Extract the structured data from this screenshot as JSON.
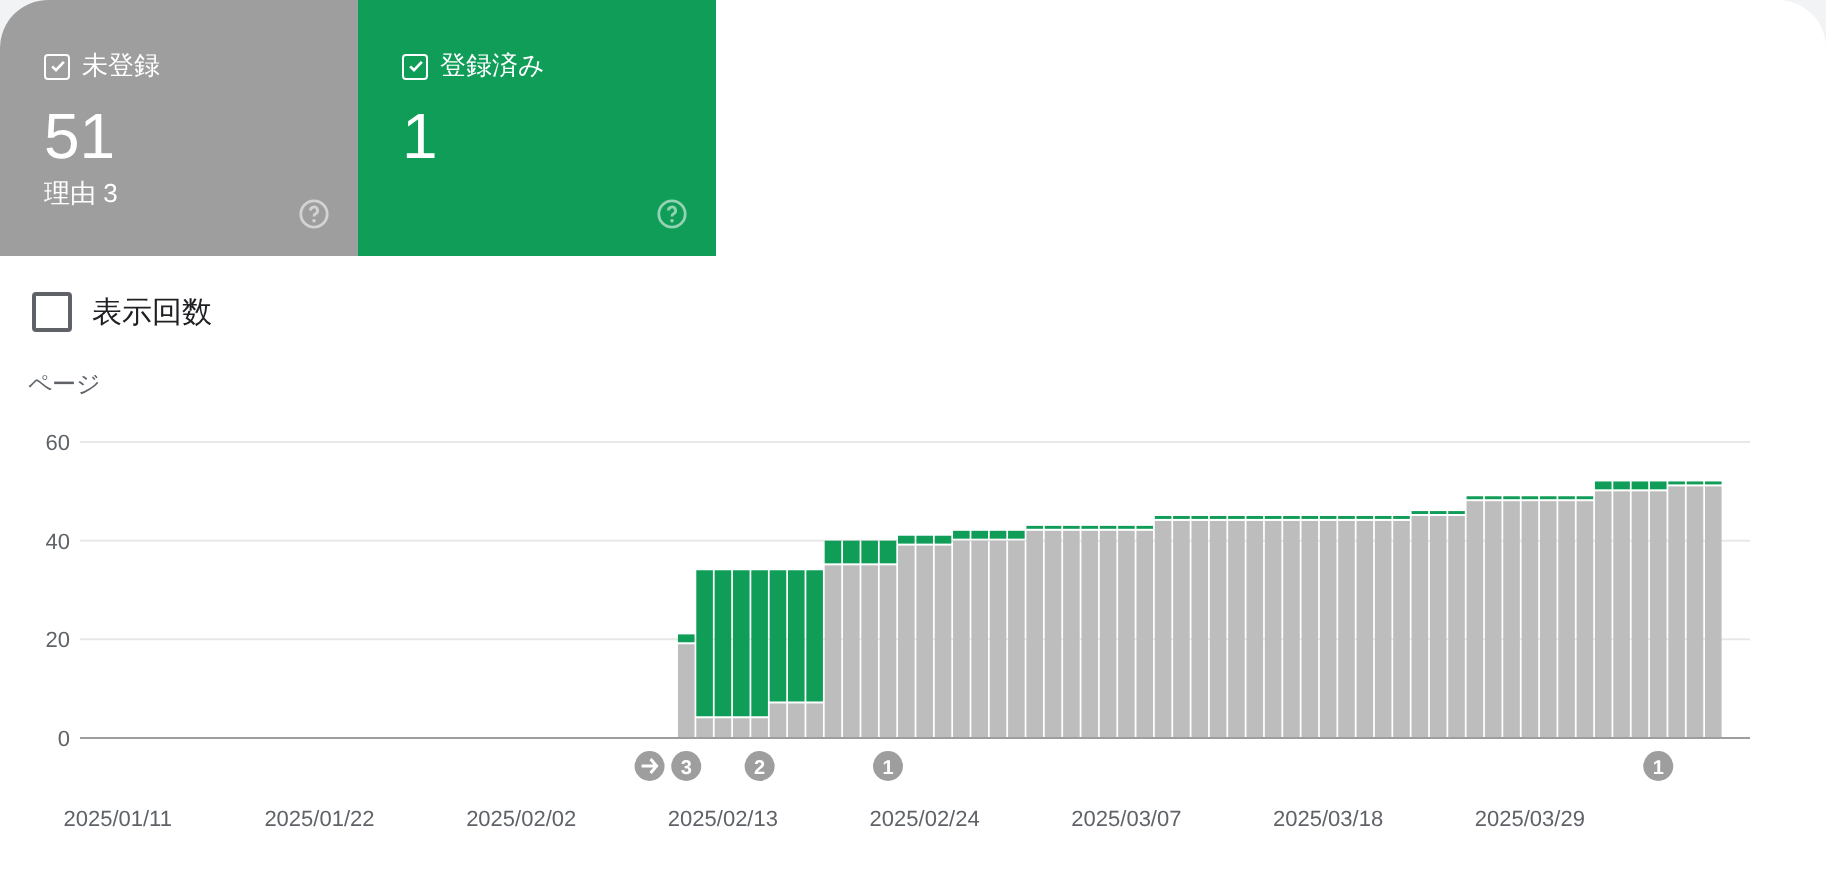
{
  "tiles": [
    {
      "label": "未登録",
      "count": "51",
      "subtitle": "理由 3",
      "checked": true,
      "color": "#9e9e9e"
    },
    {
      "label": "登録済み",
      "count": "1",
      "checked": true,
      "color": "#0f9d58"
    }
  ],
  "impressions_toggle": {
    "label": "表示回数",
    "checked": false
  },
  "chart": {
    "chart_data": {
      "type": "bar",
      "stacked": true,
      "ylabel": "ページ",
      "ylim": [
        0,
        60
      ],
      "yticks": [
        0,
        20,
        40,
        60
      ],
      "categories": [
        null,
        "2025/01/11",
        null,
        null,
        null,
        null,
        null,
        null,
        null,
        null,
        null,
        null,
        "2025/01/22",
        null,
        null,
        null,
        null,
        null,
        null,
        null,
        null,
        null,
        null,
        "2025/02/02",
        null,
        null,
        null,
        null,
        null,
        null,
        null,
        null,
        null,
        null,
        "2025/02/13",
        null,
        null,
        null,
        null,
        null,
        null,
        null,
        null,
        null,
        null,
        "2025/02/24",
        null,
        null,
        null,
        null,
        null,
        null,
        null,
        null,
        null,
        null,
        "2025/03/07",
        null,
        null,
        null,
        null,
        null,
        null,
        null,
        null,
        null,
        null,
        "2025/03/18",
        null,
        null,
        null,
        null,
        null,
        null,
        null,
        null,
        null,
        null,
        "2025/03/29",
        null,
        null,
        null,
        null,
        null,
        null,
        null,
        null,
        null,
        null,
        null,
        null
      ],
      "series": [
        {
          "color": "#bdbdbd",
          "values": [
            null,
            null,
            null,
            null,
            null,
            null,
            null,
            null,
            null,
            null,
            null,
            null,
            null,
            null,
            null,
            null,
            null,
            null,
            null,
            null,
            null,
            null,
            null,
            null,
            null,
            null,
            null,
            null,
            null,
            null,
            null,
            null,
            19,
            4,
            4,
            4,
            4,
            7,
            7,
            7,
            35,
            35,
            35,
            35,
            39,
            39,
            39,
            40,
            40,
            40,
            40,
            42,
            42,
            42,
            42,
            42,
            42,
            42,
            44,
            44,
            44,
            44,
            44,
            44,
            44,
            44,
            44,
            44,
            44,
            44,
            44,
            44,
            45,
            45,
            45,
            48,
            48,
            48,
            48,
            48,
            48,
            48,
            50,
            50,
            50,
            50,
            51,
            51,
            51,
            null,
            null
          ]
        },
        {
          "color": "#0f9d58",
          "values": [
            null,
            null,
            null,
            null,
            null,
            null,
            null,
            null,
            null,
            null,
            null,
            null,
            null,
            null,
            null,
            null,
            null,
            null,
            null,
            null,
            null,
            null,
            null,
            null,
            null,
            null,
            null,
            null,
            null,
            null,
            null,
            null,
            2,
            30,
            30,
            30,
            30,
            27,
            27,
            27,
            5,
            5,
            5,
            5,
            2,
            2,
            2,
            2,
            2,
            2,
            2,
            1,
            1,
            1,
            1,
            1,
            1,
            1,
            1,
            1,
            1,
            1,
            1,
            1,
            1,
            1,
            1,
            1,
            1,
            1,
            1,
            1,
            1,
            1,
            1,
            1,
            1,
            1,
            1,
            1,
            1,
            1,
            2,
            2,
            2,
            2,
            1,
            1,
            1,
            null,
            null
          ]
        }
      ]
    },
    "markers": [
      {
        "kind": "arrow"
      },
      {
        "kind": "count",
        "text": "3"
      },
      {
        "kind": "count",
        "text": "2"
      },
      {
        "kind": "count",
        "text": "1"
      },
      {
        "kind": "count",
        "text": "1"
      }
    ]
  }
}
